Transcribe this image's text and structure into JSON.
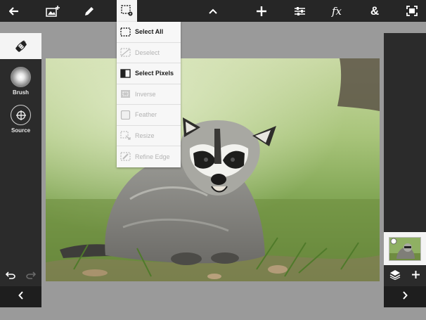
{
  "toolbar": {
    "icons": [
      "back-arrow-icon",
      "add-image-icon",
      "pencil-icon",
      "selection-settings-icon",
      "chevron-up-icon",
      "move-plus-icon",
      "adjustments-sliders-icon",
      "fx-icon",
      "ampersand-icon",
      "fullscreen-icon"
    ],
    "fx_label": "fx",
    "amp_label": "&"
  },
  "left_panel": {
    "active_tool": "healing-brush-icon",
    "tools": [
      {
        "label": "Brush",
        "icon": "brush-softness-icon"
      },
      {
        "label": "Source",
        "icon": "source-target-icon"
      }
    ],
    "undo_icon": "undo-icon",
    "redo_icon": "redo-icon",
    "collapse_icon": "chevron-left-icon"
  },
  "selection_menu": {
    "items": [
      {
        "label": "Select All",
        "enabled": true,
        "icon": "select-all-icon"
      },
      {
        "label": "Deselect",
        "enabled": false,
        "icon": "deselect-icon"
      },
      {
        "label": "Select Pixels",
        "enabled": true,
        "icon": "select-pixels-icon"
      },
      {
        "label": "Inverse",
        "enabled": false,
        "icon": "inverse-icon"
      },
      {
        "label": "Feather",
        "enabled": false,
        "icon": "feather-icon"
      },
      {
        "label": "Resize",
        "enabled": false,
        "icon": "resize-icon"
      },
      {
        "label": "Refine Edge",
        "enabled": false,
        "icon": "refine-edge-icon"
      }
    ]
  },
  "right_panel": {
    "layer_thumbnail": "raccoon-layer-thumbnail",
    "layers_icon": "layers-icon",
    "add_icon": "plus-icon",
    "expand_icon": "chevron-right-icon"
  },
  "colors": {
    "toolbar_bg": "#262626",
    "panel_bg": "#2b2b2b",
    "workspace_bg": "#9a9a9a",
    "active_bg": "#f4f4f4"
  }
}
